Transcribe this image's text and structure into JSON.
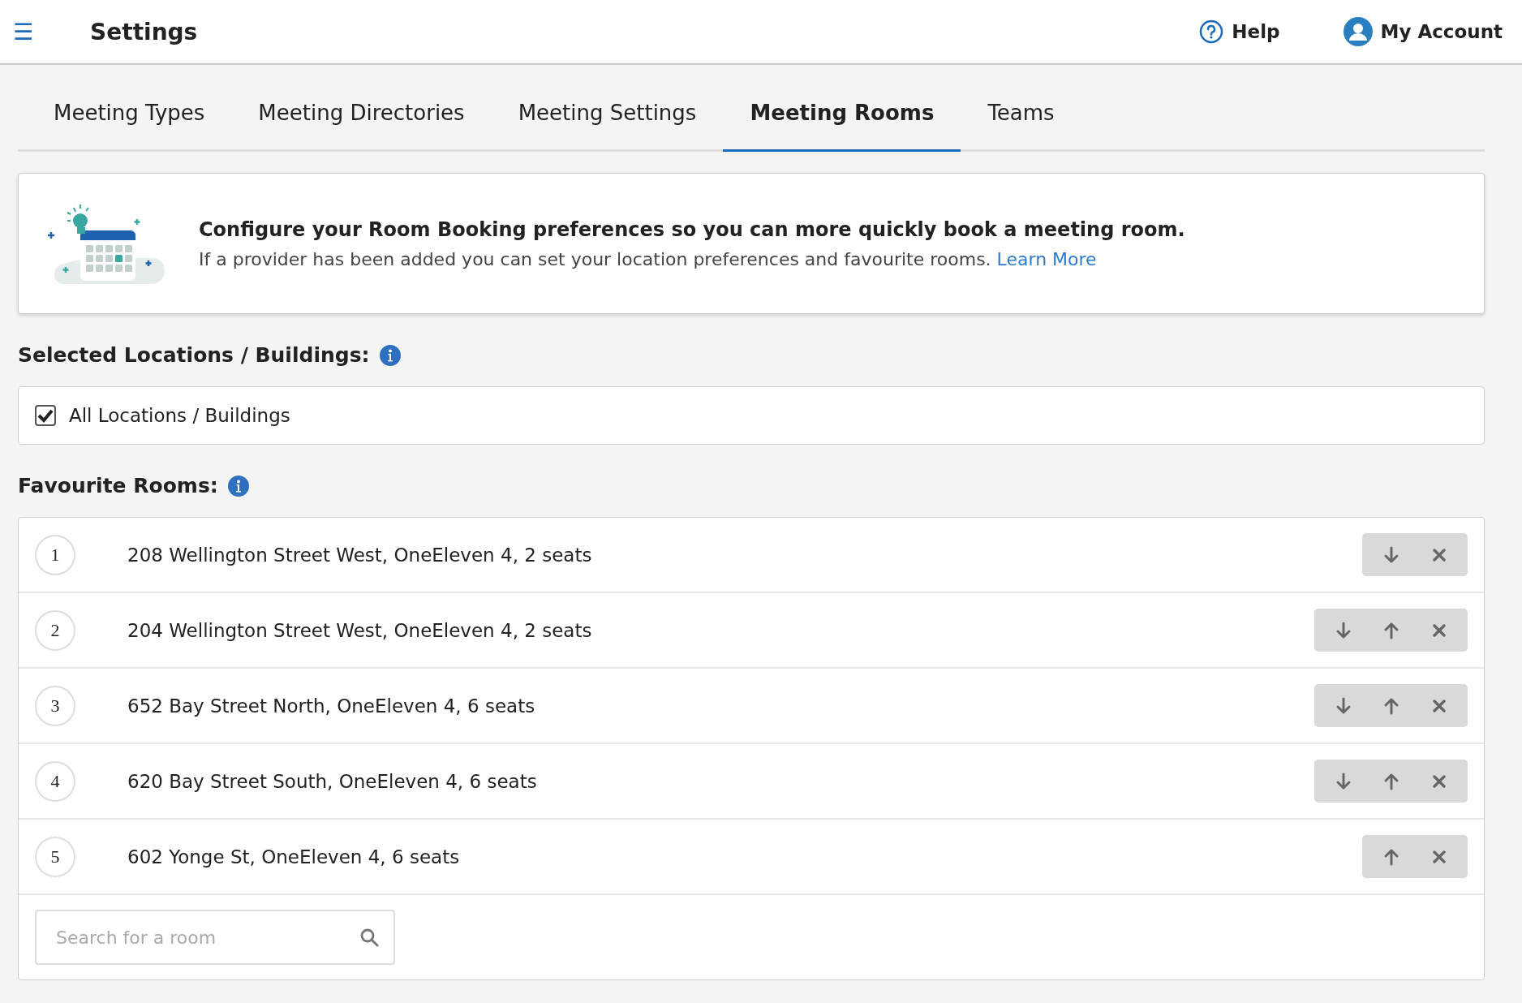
{
  "header": {
    "menu_icon": "☰",
    "title": "Settings",
    "help": "Help",
    "account": "My Account"
  },
  "tabs": [
    {
      "label": "Meeting Types",
      "selected": false
    },
    {
      "label": "Meeting Directories",
      "selected": false
    },
    {
      "label": "Meeting Settings",
      "selected": false
    },
    {
      "label": "Meeting Rooms",
      "selected": true
    },
    {
      "label": "Teams",
      "selected": false
    }
  ],
  "banner": {
    "heading": "Configure your Room Booking preferences so you can more quickly book a meeting room.",
    "text": "If a provider has been added you can set your location preferences and favourite rooms.",
    "link": "Learn More"
  },
  "locations": {
    "heading": "Selected Locations / Buildings:",
    "option": {
      "label": "All Locations / Buildings",
      "checked": true
    }
  },
  "favourites": {
    "heading": "Favourite Rooms:",
    "rooms": [
      {
        "number": "1",
        "name": "208 Wellington Street West, OneEleven 4, 2 seats",
        "move_down": true,
        "move_up": false
      },
      {
        "number": "2",
        "name": "204 Wellington Street West, OneEleven 4, 2 seats",
        "move_down": true,
        "move_up": true
      },
      {
        "number": "3",
        "name": "652 Bay Street North, OneEleven 4, 6 seats",
        "move_down": true,
        "move_up": true
      },
      {
        "number": "4",
        "name": "620 Bay Street South, OneEleven 4, 6 seats",
        "move_down": true,
        "move_up": true
      },
      {
        "number": "5",
        "name": "602 Yonge St, OneEleven 4, 6 seats",
        "move_down": false,
        "move_up": true
      }
    ],
    "search": {
      "placeholder": "Search for a room"
    }
  }
}
